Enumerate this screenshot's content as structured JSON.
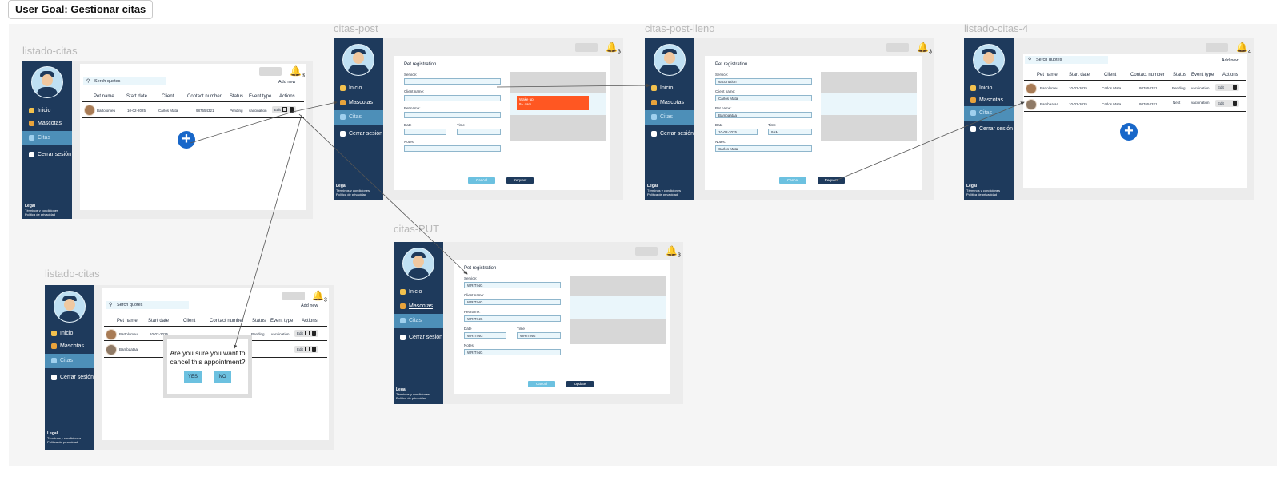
{
  "user_goal": "User Goal: Gestionar citas",
  "app": {
    "bell_count": "3",
    "bell_count_alt": "4",
    "legal": {
      "title": "Legal",
      "terms": "Términos y condiciones",
      "privacy": "Política de privacidad"
    },
    "nav": {
      "inicio": "Inicio",
      "mascotas": "Mascotas",
      "citas": "Citas",
      "logout": "Cerrar sesión"
    },
    "colors": {
      "sidebar": "#1e3a5c",
      "active": "#4d8fb8",
      "accent": "#1867c9",
      "toast": "#ff5722",
      "button": "#6cc1e0"
    }
  },
  "frames": {
    "listado": {
      "title": "listado-citas"
    },
    "post": {
      "title": "citas-post"
    },
    "post_lleno": {
      "title": "citas-post-lleno"
    },
    "listado4": {
      "title": "listado-citas-4"
    },
    "put": {
      "title": "citas-PUT"
    },
    "listado_modal": {
      "title": "listado-citas"
    }
  },
  "table": {
    "search_placeholder": "Serch quotes",
    "add_new": "Add new",
    "headers": {
      "pet": "Pet name",
      "start": "Start date",
      "client": "Client",
      "contact": "Contact number",
      "status": "Status",
      "event": "Event type",
      "actions": "Actions"
    },
    "edit": "Edit",
    "rows": [
      {
        "pet": "Bartolomeu",
        "date": "10-02-2025",
        "client": "Carlos Mata",
        "contact": "987654321",
        "status": "Pending",
        "event": "vaccination"
      },
      {
        "pet": "Bambaataa",
        "date": "10-02-2025",
        "client": "Carlos Mata",
        "contact": "987654321",
        "status": "Next",
        "event": "vaccination"
      }
    ]
  },
  "form": {
    "title": "Pet registration",
    "service": "Service:",
    "client_name": "Client name:",
    "pet_name": "Pet name:",
    "date": "Date",
    "time": "Time",
    "notes": "Notes:",
    "cancel": "Cancel",
    "request": "Request",
    "update": "Update",
    "filled": {
      "service": "vaccination",
      "client": "Carlos Mata",
      "pet": "Bambaataa",
      "date": "10-02-2025",
      "time": "9AM",
      "notes": "Carlos Mata"
    },
    "writing": "WRITING",
    "toast": {
      "line1": "Wake up",
      "line2": "9 - 4am"
    }
  },
  "dialog": {
    "question": "Are you sure you want to cancel this appointment?",
    "yes": "YES",
    "no": "NO"
  }
}
